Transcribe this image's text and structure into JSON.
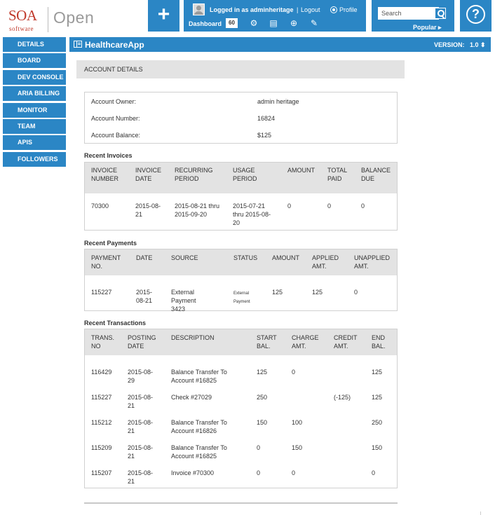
{
  "logo": {
    "brand": "SOA",
    "tagline": "software",
    "product": "Open"
  },
  "header": {
    "logged_in_text": "Logged in as adminheritage",
    "separator": "|",
    "logout": "Logout",
    "profile": "Profile",
    "dashboard": "Dashboard",
    "dashboard_count": "60",
    "search_placeholder": "Search",
    "popular": "Popular ▸",
    "help": "?",
    "plus": "+"
  },
  "sidebar": {
    "items": [
      {
        "label": "DETAILS"
      },
      {
        "label": "BOARD"
      },
      {
        "label": "DEV CONSOLE"
      },
      {
        "label": "ARIA BILLING"
      },
      {
        "label": "MONITOR"
      },
      {
        "label": "TEAM"
      },
      {
        "label": "APIS"
      },
      {
        "label": "FOLLOWERS"
      }
    ]
  },
  "app_bar": {
    "title": "HealthcareApp",
    "version_label": "VERSION:",
    "version_value": "1.0 ⬍"
  },
  "account": {
    "heading": "ACCOUNT DETAILS",
    "owner_label": "Account Owner:",
    "owner_value": "admin heritage",
    "number_label": "Account Number:",
    "number_value": "16824",
    "balance_label": "Account Balance:",
    "balance_value": "$125"
  },
  "invoices": {
    "title": "Recent Invoices",
    "headers": [
      "INVOICE NUMBER",
      "INVOICE DATE",
      "RECURRING PERIOD",
      "USAGE PERIOD",
      "AMOUNT",
      "TOTAL PAID",
      "BALANCE DUE"
    ],
    "rows": [
      [
        "70300",
        "2015-08-21",
        "2015-08-21 thru 2015-09-20",
        "2015-07-21 thru 2015-08-20",
        "0",
        "0",
        "0"
      ]
    ]
  },
  "payments": {
    "title": "Recent Payments",
    "headers": [
      "PAYMENT NO.",
      "DATE",
      "SOURCE",
      "STATUS",
      "AMOUNT",
      "APPLIED AMT.",
      "UNAPPLIED AMT."
    ],
    "rows": [
      [
        "115227",
        "2015-08-21",
        "External Payment 3423",
        "External Payment",
        "125",
        "125",
        "0"
      ]
    ]
  },
  "transactions": {
    "title": "Recent Transactions",
    "headers": [
      "TRANS. NO",
      "POSTING DATE",
      "DESCRIPTION",
      "START BAL.",
      "CHARGE AMT.",
      "CREDIT AMT.",
      "END BAL."
    ],
    "rows": [
      [
        "116429",
        "2015-08-29",
        "Balance Transfer To Account #16825",
        "125",
        "0",
        "",
        "125"
      ],
      [
        "115227",
        "2015-08-21",
        "Check #27029",
        "250",
        "",
        "(-125)",
        "125"
      ],
      [
        "115212",
        "2015-08-21",
        "Balance Transfer To Account #16826",
        "150",
        "100",
        "",
        "250"
      ],
      [
        "115209",
        "2015-08-21",
        "Balance Transfer To Account #16825",
        "0",
        "150",
        "",
        "150"
      ],
      [
        "115207",
        "2015-08-21",
        "Invoice #70300",
        "0",
        "0",
        "",
        "0"
      ]
    ]
  }
}
